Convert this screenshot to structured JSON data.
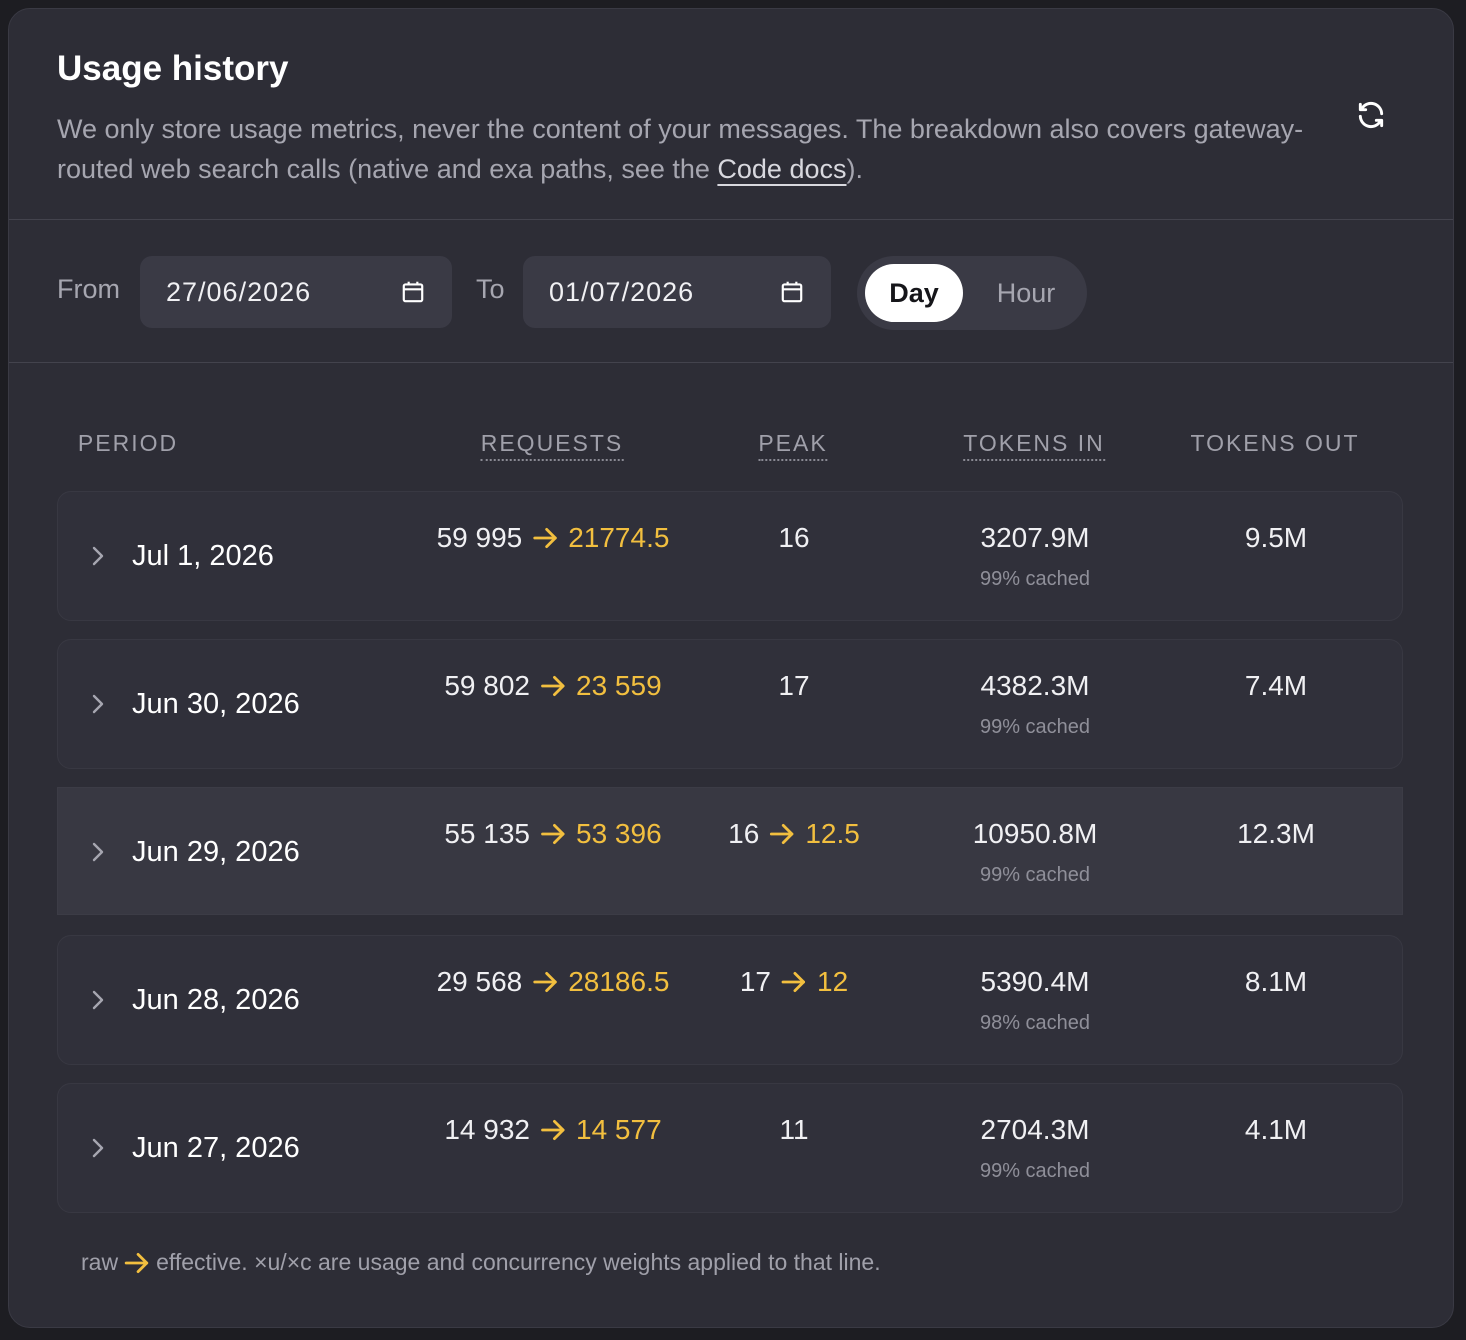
{
  "header": {
    "title": "Usage history",
    "description_before": "We only store usage metrics, never the content of your messages. The breakdown also covers gateway-routed web search calls (native and exa paths, see the ",
    "docs_link": "Code docs",
    "description_after": ")."
  },
  "filters": {
    "from_label": "From",
    "from_value": "27/06/2026",
    "to_label": "To",
    "to_value": "01/07/2026",
    "granularity": {
      "day": "Day",
      "hour": "Hour",
      "selected": "Day"
    }
  },
  "table": {
    "columns": [
      "PERIOD",
      "REQUESTS",
      "PEAK",
      "TOKENS IN",
      "TOKENS OUT"
    ],
    "rows": [
      {
        "period": "Jul 1, 2026",
        "requests_raw": "59 995",
        "requests_eff": "21774.5",
        "peak_raw": "16",
        "peak_eff": "",
        "tokens_in": "3207.9M",
        "cached": "99% cached",
        "tokens_out": "9.5M"
      },
      {
        "period": "Jun 30, 2026",
        "requests_raw": "59 802",
        "requests_eff": "23 559",
        "peak_raw": "17",
        "peak_eff": "",
        "tokens_in": "4382.3M",
        "cached": "99% cached",
        "tokens_out": "7.4M"
      },
      {
        "period": "Jun 29, 2026",
        "requests_raw": "55 135",
        "requests_eff": "53 396",
        "peak_raw": "16",
        "peak_eff": "12.5",
        "tokens_in": "10950.8M",
        "cached": "99% cached",
        "tokens_out": "12.3M"
      },
      {
        "period": "Jun 28, 2026",
        "requests_raw": "29 568",
        "requests_eff": "28186.5",
        "peak_raw": "17",
        "peak_eff": "12",
        "tokens_in": "5390.4M",
        "cached": "98% cached",
        "tokens_out": "8.1M"
      },
      {
        "period": "Jun 27, 2026",
        "requests_raw": "14 932",
        "requests_eff": "14 577",
        "peak_raw": "11",
        "peak_eff": "",
        "tokens_in": "2704.3M",
        "cached": "99% cached",
        "tokens_out": "4.1M"
      }
    ]
  },
  "footnote": {
    "before": "raw",
    "after": "effective. ×u/×c are usage and concurrency weights applied to that line."
  },
  "colors": {
    "accent": "#f2bf3f",
    "panel": "#2d2d36",
    "muted": "#a6a6b0"
  },
  "icons": {
    "refresh": "refresh-icon",
    "calendar": "calendar-icon",
    "chevron": "chevron-right-icon",
    "arrow": "arrow-right-icon"
  }
}
